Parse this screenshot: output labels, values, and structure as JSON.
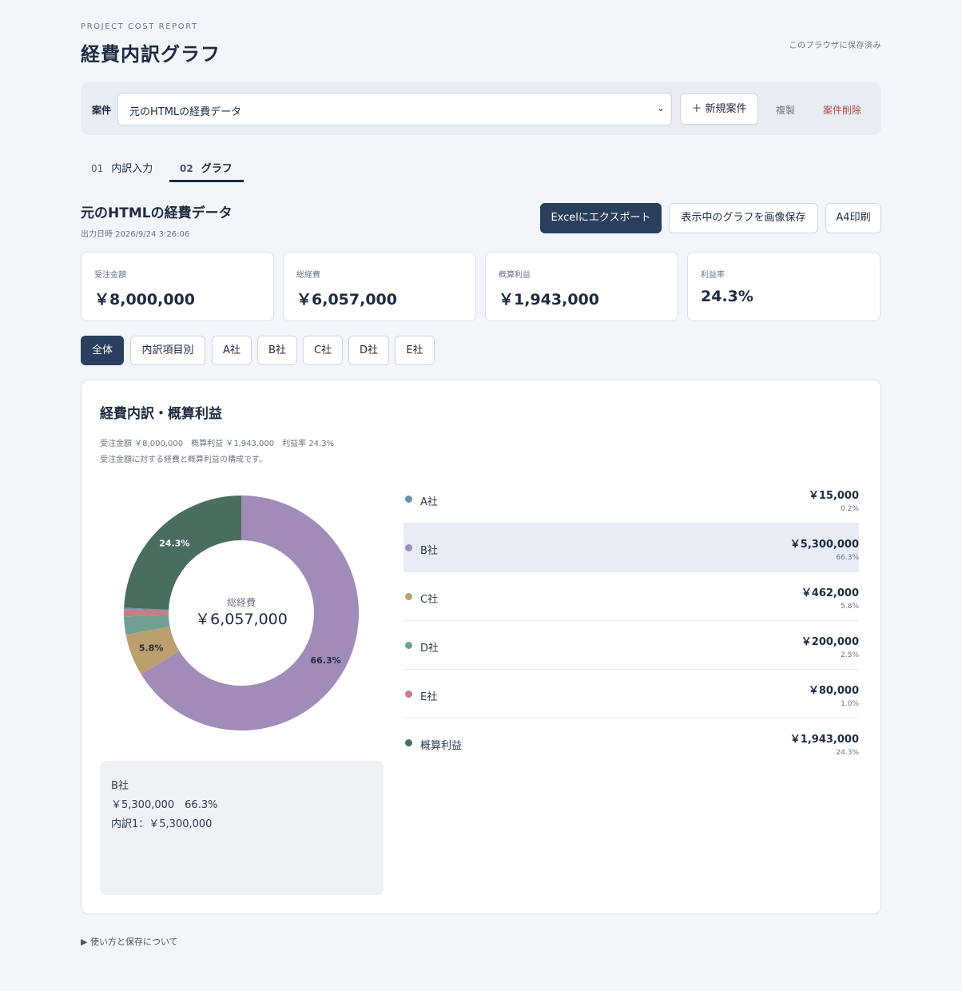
{
  "header": {
    "eyebrow": "PROJECT COST REPORT",
    "title": "経費内訳グラフ",
    "saved_note": "このブラウザに保存済み"
  },
  "case_bar": {
    "label": "案件",
    "selected_case": "元のHTMLの経費データ",
    "new_button": "＋ 新規案件",
    "copy_button": "複製",
    "delete_button": "案件削除"
  },
  "tabs": [
    {
      "num": "01",
      "label": "内訳入力"
    },
    {
      "num": "02",
      "label": "グラフ"
    }
  ],
  "report": {
    "title": "元のHTMLの経費データ",
    "export_time": "出力日時 2026/9/24 3:26:06",
    "excel_button": "Excelにエクスポート",
    "image_button": "表示中のグラフを画像保存",
    "print_button": "A4印刷"
  },
  "stats": [
    {
      "label": "受注金額",
      "value": "￥8,000,000"
    },
    {
      "label": "総経費",
      "value": "￥6,057,000"
    },
    {
      "label": "概算利益",
      "value": "￥1,943,000"
    },
    {
      "label": "利益率",
      "value": "24.3%"
    }
  ],
  "filters": [
    "全体",
    "内訳項目別",
    "A社",
    "B社",
    "C社",
    "D社",
    "E社"
  ],
  "panel": {
    "title": "経費内訳・概算利益",
    "sub1": "受注金額 ￥8,000,000　概算利益 ￥1,943,000　利益率 24.3%",
    "sub2": "受注金額に対する経費と概算利益の構成です。",
    "center_label": "総経費",
    "center_value": "￥6,057,000"
  },
  "info_box": {
    "name": "B社",
    "amount_line": "￥5,300,000　66.3%",
    "detail_line": "内訳1：￥5,300,000"
  },
  "chart_data": {
    "type": "pie",
    "categories": [
      "A社",
      "B社",
      "C社",
      "D社",
      "E社",
      "概算利益"
    ],
    "values": [
      15000,
      5300000,
      462000,
      200000,
      80000,
      1943000
    ],
    "amount_labels": [
      "￥15,000",
      "￥5,300,000",
      "￥462,000",
      "￥200,000",
      "￥80,000",
      "￥1,943,000"
    ],
    "percent_labels": [
      "0.2%",
      "66.3%",
      "5.8%",
      "2.5%",
      "1.0%",
      "24.3%"
    ],
    "colors": [
      "#6f8fae",
      "#a08bb9",
      "#bb9f6d",
      "#6f9f92",
      "#c47f82",
      "#4a6e5d"
    ],
    "highlighted": "B社"
  },
  "footer": {
    "note": "▶ 使い方と保存について"
  }
}
